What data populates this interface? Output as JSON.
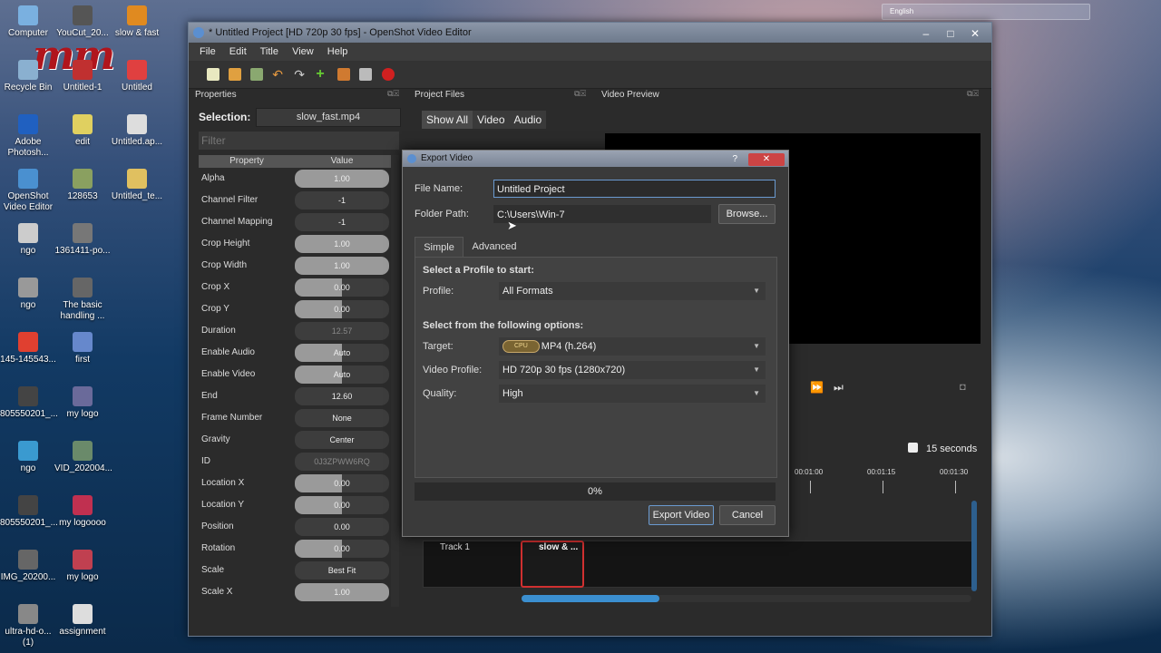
{
  "desktop": {
    "icons": [
      {
        "label": "Computer"
      },
      {
        "label": "YouCut_20..."
      },
      {
        "label": "slow & fast"
      },
      {
        "label": "Recycle Bin"
      },
      {
        "label": "Untitled-1"
      },
      {
        "label": "Untitled"
      },
      {
        "label": "Adobe Photosh..."
      },
      {
        "label": "edit"
      },
      {
        "label": "Untitled.ap..."
      },
      {
        "label": "OpenShot Video Editor"
      },
      {
        "label": "128653"
      },
      {
        "label": "Untitled_te..."
      },
      {
        "label": "ngo"
      },
      {
        "label": "1361411-po..."
      },
      {
        "label": "ngo"
      },
      {
        "label": "The basic handling ..."
      },
      {
        "label": "145-145543..."
      },
      {
        "label": "first"
      },
      {
        "label": "805550201_..."
      },
      {
        "label": "my logo"
      },
      {
        "label": "ngo"
      },
      {
        "label": "VID_202004..."
      },
      {
        "label": "805550201_..."
      },
      {
        "label": "my logoooo"
      },
      {
        "label": "IMG_20200..."
      },
      {
        "label": "my logo"
      },
      {
        "label": "ultra-hd-o... (1)"
      },
      {
        "label": "assignment"
      }
    ],
    "watermark": "mm",
    "tray_language": "English"
  },
  "window": {
    "title": "* Untitled Project [HD 720p 30 fps] - OpenShot Video Editor",
    "menu": [
      "File",
      "Edit",
      "Title",
      "View",
      "Help"
    ]
  },
  "properties": {
    "panel_title": "Properties",
    "selection_label": "Selection:",
    "selection_value": "slow_fast.mp4",
    "filter_placeholder": "Filter",
    "col_property": "Property",
    "col_value": "Value",
    "rows": [
      {
        "name": "Alpha",
        "value": "1.00",
        "level": 1.0
      },
      {
        "name": "Channel Filter",
        "value": "-1",
        "level": 0
      },
      {
        "name": "Channel Mapping",
        "value": "-1",
        "level": 0
      },
      {
        "name": "Crop Height",
        "value": "1.00",
        "level": 1.0
      },
      {
        "name": "Crop Width",
        "value": "1.00",
        "level": 1.0
      },
      {
        "name": "Crop X",
        "value": "0.00",
        "level": 0.5
      },
      {
        "name": "Crop Y",
        "value": "0.00",
        "level": 0.5
      },
      {
        "name": "Duration",
        "value": "12.57",
        "level": 0
      },
      {
        "name": "Enable Audio",
        "value": "Auto",
        "level": 0.5
      },
      {
        "name": "Enable Video",
        "value": "Auto",
        "level": 0.5
      },
      {
        "name": "End",
        "value": "12.60",
        "level": 0
      },
      {
        "name": "Frame Number",
        "value": "None",
        "level": 0
      },
      {
        "name": "Gravity",
        "value": "Center",
        "level": 0
      },
      {
        "name": "ID",
        "value": "0J3ZPWW6RQ",
        "level": 0
      },
      {
        "name": "Location X",
        "value": "0.00",
        "level": 0.5
      },
      {
        "name": "Location Y",
        "value": "0.00",
        "level": 0.5
      },
      {
        "name": "Position",
        "value": "0.00",
        "level": 0
      },
      {
        "name": "Rotation",
        "value": "0.00",
        "level": 0.5
      },
      {
        "name": "Scale",
        "value": "Best Fit",
        "level": 0
      },
      {
        "name": "Scale X",
        "value": "1.00",
        "level": 1.0
      }
    ]
  },
  "project_files": {
    "panel_title": "Project Files",
    "tabs": [
      "Show All",
      "Video",
      "Audio"
    ]
  },
  "video_preview": {
    "panel_title": "Video Preview"
  },
  "timeline": {
    "zoom_label": "15 seconds",
    "ruler": [
      "00:01:00",
      "00:01:15",
      "00:01:30"
    ],
    "track_label": "Track 1",
    "clip_label": "slow & ..."
  },
  "export_dialog": {
    "title": "Export Video",
    "help_btn": "?",
    "close_btn": "✕",
    "file_name_label": "File Name:",
    "file_name_value": "Untitled Project",
    "folder_path_label": "Folder Path:",
    "folder_path_value": "C:\\Users\\Win-7",
    "browse_label": "Browse...",
    "tab_simple": "Simple",
    "tab_advanced": "Advanced",
    "profile_heading": "Select a Profile to start:",
    "profile_label": "Profile:",
    "profile_value": "All Formats",
    "options_heading": "Select from the following options:",
    "target_label": "Target:",
    "target_badge": "CPU",
    "target_value": "MP4 (h.264)",
    "video_profile_label": "Video Profile:",
    "video_profile_value": "HD 720p 30 fps (1280x720)",
    "quality_label": "Quality:",
    "quality_value": "High",
    "progress_text": "0%",
    "progress_value": 0,
    "export_label": "Export Video",
    "cancel_label": "Cancel"
  }
}
